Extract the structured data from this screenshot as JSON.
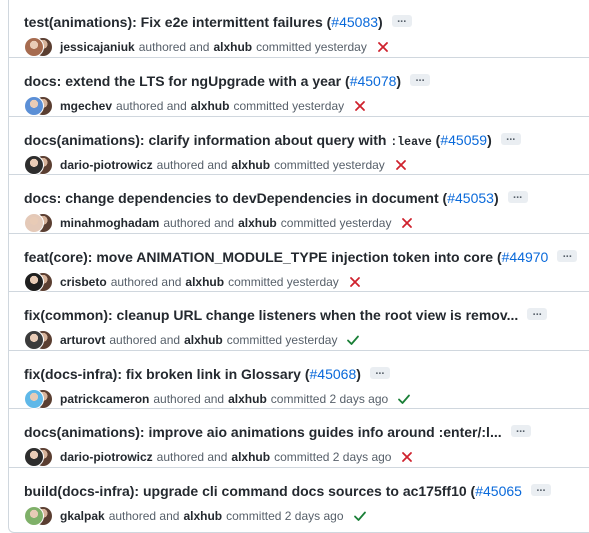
{
  "colors": {
    "fail": "#cf222e",
    "success": "#1a7f37",
    "link": "#0969da",
    "border": "#d0d7de"
  },
  "commits": [
    {
      "title": "test(animations): Fix e2e intermittent failures",
      "code": "",
      "title_suffix": "",
      "pr": "#45083",
      "pr_close": ")",
      "author": "jessicajaniuk",
      "authored_text": "authored and",
      "committer": "alxhub",
      "committed_text": "committed yesterday",
      "status": "fail",
      "status_icon": "x-icon",
      "avatar_color": "#a66b4f"
    },
    {
      "title": "docs: extend the LTS for ngUpgrade with a year",
      "code": "",
      "title_suffix": "",
      "pr": "#45078",
      "pr_close": ")",
      "author": "mgechev",
      "authored_text": "authored and",
      "committer": "alxhub",
      "committed_text": "committed yesterday",
      "status": "fail",
      "status_icon": "x-icon",
      "avatar_color": "#5b8fd6"
    },
    {
      "title": "docs(animations): clarify information about query with",
      "code": ":leave",
      "title_suffix": "",
      "pr": "#45059",
      "pr_close": ")",
      "author": "dario-piotrowicz",
      "authored_text": "authored and",
      "committer": "alxhub",
      "committed_text": "committed yesterday",
      "status": "fail",
      "status_icon": "x-icon",
      "avatar_color": "#2d2d2d"
    },
    {
      "title": "docs: change dependencies to devDependencies in document",
      "code": "",
      "title_suffix": "",
      "pr": "#45053",
      "pr_close": ")",
      "author": "minahmoghadam",
      "authored_text": "authored and",
      "committer": "alxhub",
      "committed_text": "committed yesterday",
      "status": "fail",
      "status_icon": "x-icon",
      "avatar_color": "#e4c9b8"
    },
    {
      "title": "feat(core): move ANIMATION_MODULE_TYPE injection token into core",
      "code": "",
      "title_suffix": "",
      "pr": "#44970",
      "pr_close": "",
      "author": "crisbeto",
      "authored_text": "authored and",
      "committer": "alxhub",
      "committed_text": "committed yesterday",
      "status": "fail",
      "status_icon": "x-icon",
      "avatar_color": "#1f1f1f"
    },
    {
      "title": "fix(common): cleanup URL change listeners when the root view is remov...",
      "code": "",
      "title_suffix": "",
      "pr": "",
      "pr_close": "",
      "author": "arturovt",
      "authored_text": "authored and",
      "committer": "alxhub",
      "committed_text": "committed yesterday",
      "status": "success",
      "status_icon": "check-icon",
      "avatar_color": "#3b3b3b"
    },
    {
      "title": "fix(docs-infra): fix broken link in Glossary",
      "code": "",
      "title_suffix": "",
      "pr": "#45068",
      "pr_close": ")",
      "author": "patrickcameron",
      "authored_text": "authored and",
      "committer": "alxhub",
      "committed_text": "committed 2 days ago",
      "status": "success",
      "status_icon": "check-icon",
      "avatar_color": "#5fb8e8"
    },
    {
      "title": "docs(animations): improve aio animations guides info around :enter/:l...",
      "code": "",
      "title_suffix": "",
      "pr": "",
      "pr_close": "",
      "author": "dario-piotrowicz",
      "authored_text": "authored and",
      "committer": "alxhub",
      "committed_text": "committed 2 days ago",
      "status": "fail",
      "status_icon": "x-icon",
      "avatar_color": "#2d2d2d"
    },
    {
      "title": "build(docs-infra): upgrade cli command docs sources to ac175ff10",
      "code": "",
      "title_suffix": "",
      "pr": "#45065",
      "pr_close": "",
      "author": "gkalpak",
      "authored_text": "authored and",
      "committer": "alxhub",
      "committed_text": "committed 2 days ago",
      "status": "success",
      "status_icon": "check-icon",
      "avatar_color": "#7fb069"
    }
  ],
  "ellipsis_label": "..."
}
